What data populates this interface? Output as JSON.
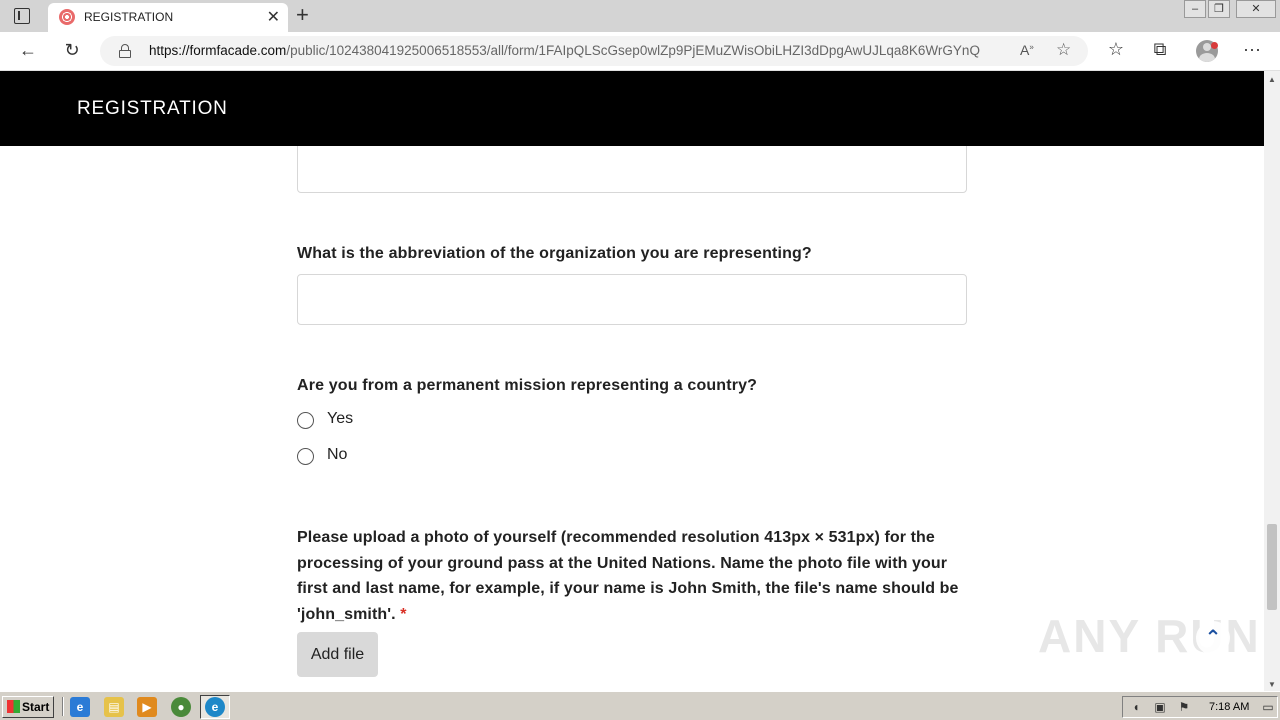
{
  "browser": {
    "tab_title": "REGISTRATION",
    "url_host": "https://formfacade.com",
    "url_path": "/public/102438041925006518553/all/form/1FAIpQLScGsep0wlZp9PjEMuZWisObiLHZI3dDpgAwUJLqa8K6WrGYnQ"
  },
  "page": {
    "header_title": "REGISTRATION",
    "question_abbreviation": "What is the abbreviation of the organization you are representing?",
    "question_mission": "Are you from a permanent mission representing a country?",
    "options": [
      "Yes",
      "No"
    ],
    "upload_instructions": "Please upload a photo of yourself (recommended resolution 413px × 531px) for the processing of your ground pass at the United Nations. Name the photo file with your first and last name, for example, if your name is John Smith, the file's name should be 'john_smith'.",
    "required_marker": "*",
    "add_file_label": "Add file",
    "watermark": "ANY RUN"
  },
  "taskbar": {
    "start_label": "Start",
    "clock": "7:18 AM"
  }
}
